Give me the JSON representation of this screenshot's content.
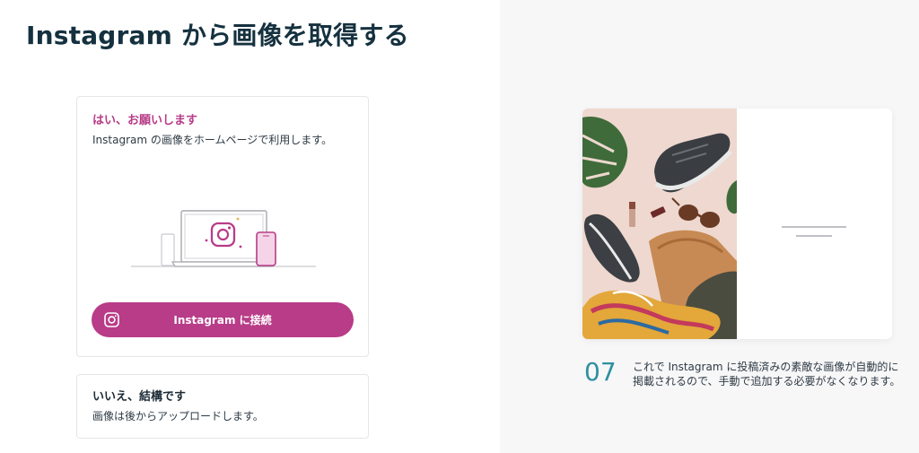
{
  "page": {
    "title": "Instagram から画像を取得する"
  },
  "option_yes": {
    "heading": "はい、お願いします",
    "description": "Instagram の画像をホームページで利用します。",
    "button_label": "Instagram に接続"
  },
  "option_no": {
    "heading": "いいえ、結構です",
    "description": "画像は後からアップロードします。"
  },
  "tip": {
    "step": "07",
    "text": "これで Instagram に投稿済みの素敵な画像が自動的に掲載されるので、手動で追加する必要がなくなります。"
  },
  "colors": {
    "accent": "#b83c88",
    "title": "#15313f",
    "step_number": "#2e8fa0",
    "right_panel_bg": "#f7f7f8"
  },
  "icons": [
    "instagram-icon",
    "laptop-illustration",
    "phone-illustration",
    "product-photo"
  ]
}
